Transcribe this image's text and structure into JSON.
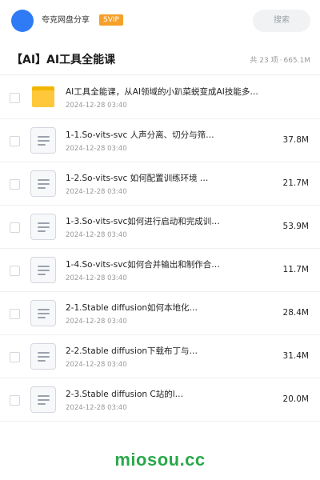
{
  "header": {
    "share_name": "夸克网盘分享",
    "badge": "SVIP",
    "search_label": "搜索",
    "accent_color": "#2f7bf5",
    "badge_color": "#f5a02a"
  },
  "folder": {
    "title": "【AI】AI工具全能课",
    "item_count": "共 23 项",
    "separator": "·",
    "total_size": "665.1M"
  },
  "files": [
    {
      "type": "folder",
      "icon": "folder-icon",
      "name": "AI工具全能课，从AI领域的小趴菜蜕变成AI技能多…",
      "date": "2024-12-28 03:40",
      "size": ""
    },
    {
      "type": "file",
      "icon": "document-icon",
      "name": "1-1.So-vits-svc 人声分离、切分与筛…",
      "date": "2024-12-28 03:40",
      "size": "37.8M"
    },
    {
      "type": "file",
      "icon": "document-icon",
      "name": "1-2.So-vits-svc 如何配置训练环境 …",
      "date": "2024-12-28 03:40",
      "size": "21.7M"
    },
    {
      "type": "file",
      "icon": "document-icon",
      "name": "1-3.So-vits-svc如何进行启动和完成训…",
      "date": "2024-12-28 03:40",
      "size": "53.9M"
    },
    {
      "type": "file",
      "icon": "document-icon",
      "name": "1-4.So-vits-svc如何合并输出和制作合…",
      "date": "2024-12-28 03:40",
      "size": "11.7M"
    },
    {
      "type": "file",
      "icon": "document-icon",
      "name": "2-1.Stable diffusion如何本地化…",
      "date": "2024-12-28 03:40",
      "size": "28.4M"
    },
    {
      "type": "file",
      "icon": "document-icon",
      "name": "2-2.Stable diffusion下载布丁与…",
      "date": "2024-12-28 03:40",
      "size": "31.4M"
    },
    {
      "type": "file",
      "icon": "document-icon",
      "name": "2-3.Stable diffusion C站的l…",
      "date": "2024-12-28 03:40",
      "size": "20.0M"
    }
  ],
  "watermark": {
    "text": "miosou.cc",
    "color": "#2aa84a"
  }
}
